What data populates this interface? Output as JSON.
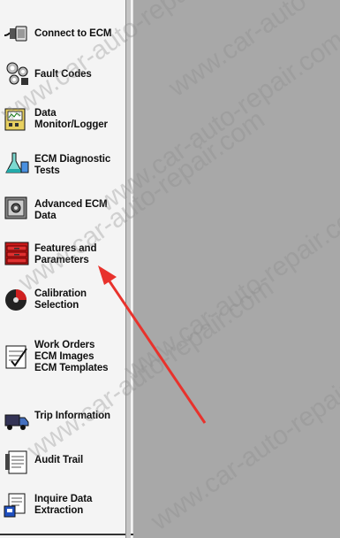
{
  "sidebar": {
    "items": [
      {
        "label": "Connect to ECM",
        "icon": "connector-cable-icon"
      },
      {
        "label": "Fault Codes",
        "icon": "fault-codes-icon"
      },
      {
        "label": "Data Monitor/Logger",
        "icon": "data-monitor-icon"
      },
      {
        "label": "ECM Diagnostic Tests",
        "icon": "diagnostic-flask-icon"
      },
      {
        "label": "Advanced ECM Data",
        "icon": "advanced-data-icon"
      },
      {
        "label": "Features and Parameters",
        "icon": "features-toolbox-icon"
      },
      {
        "label": "Calibration Selection",
        "icon": "calibration-disc-icon"
      },
      {
        "label": "Work Orders ECM Images ECM Templates",
        "icon": "work-orders-icon"
      },
      {
        "label": "Trip Information",
        "icon": "trip-truck-icon"
      },
      {
        "label": "Audit Trail",
        "icon": "audit-trail-icon"
      },
      {
        "label": "Inquire Data Extraction",
        "icon": "inquire-extraction-icon"
      }
    ]
  },
  "watermark": {
    "text": "www.car-auto-repair.com"
  },
  "colors": {
    "panel_bg": "#a8a8a8",
    "sidebar_bg": "#f4f4f4",
    "annotation_arrow": "#e8322c"
  }
}
